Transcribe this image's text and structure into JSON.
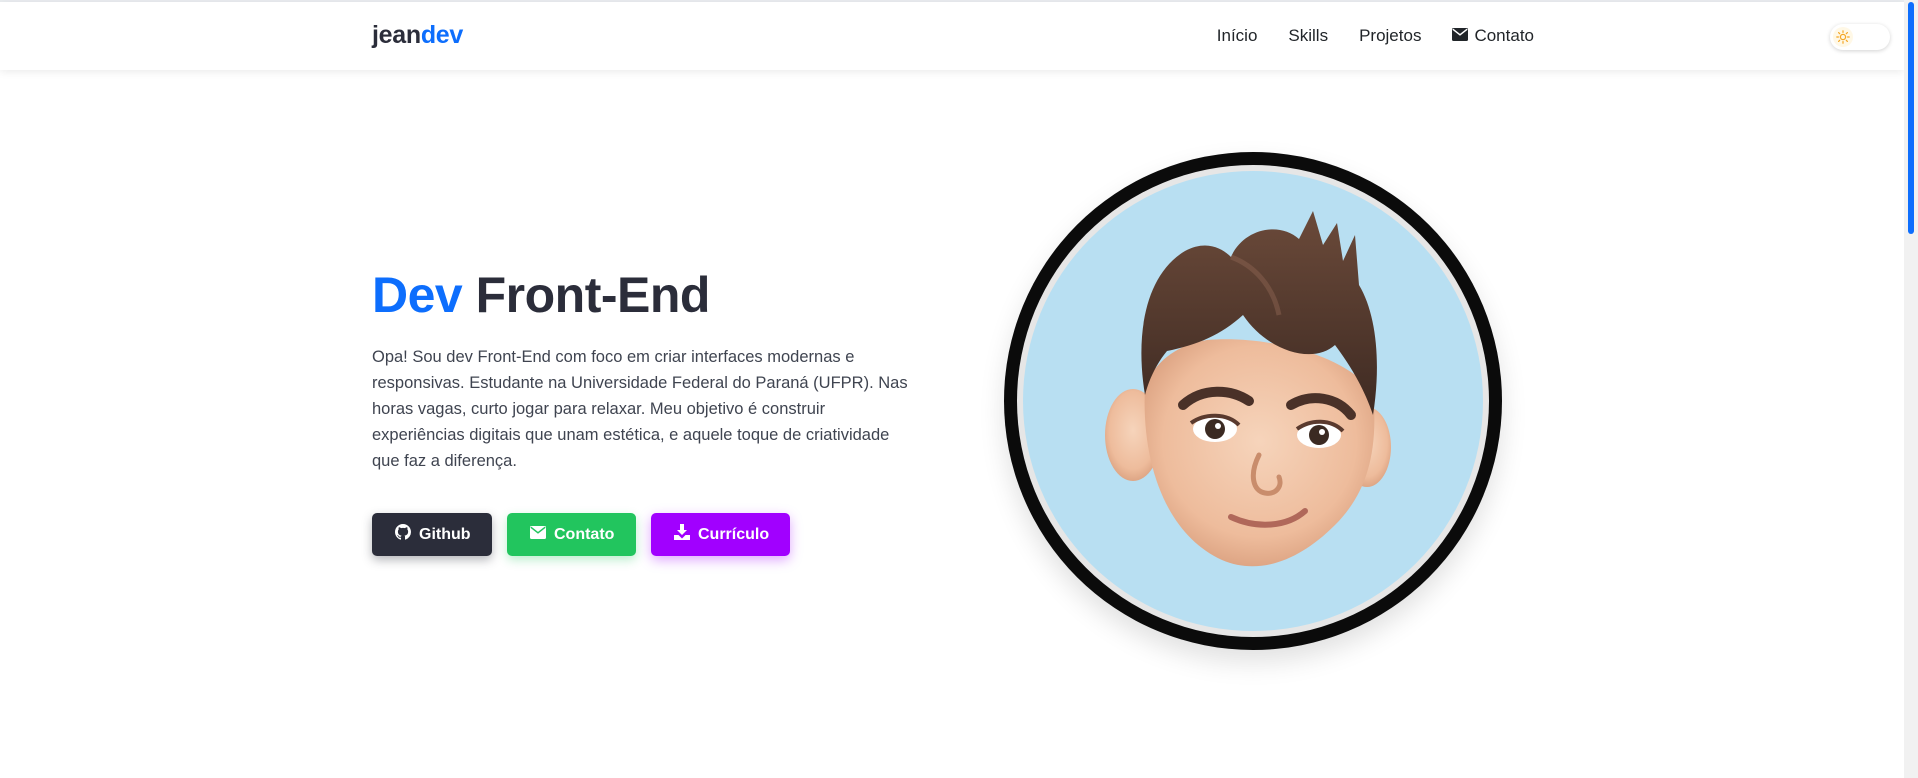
{
  "brand": {
    "part1": "jean",
    "part2": "dev"
  },
  "nav": {
    "items": [
      {
        "label": "Início",
        "icon": ""
      },
      {
        "label": "Skills",
        "icon": ""
      },
      {
        "label": "Projetos",
        "icon": ""
      },
      {
        "label": "Contato",
        "icon": "envelope-icon"
      }
    ]
  },
  "theme_toggle": {
    "mode": "light",
    "icon": "sun-icon"
  },
  "hero": {
    "title_accent": "Dev",
    "title_rest": "Front-End",
    "description": "Opa! Sou dev Front-End com foco em criar interfaces modernas e responsivas. Estudante na Universidade Federal do Paraná (UFPR). Nas horas vagas, curto jogar para relaxar. Meu objetivo é construir experiências digitais que unam estética, e aquele toque de criatividade que faz a diferença.",
    "buttons": [
      {
        "label": "Github",
        "icon": "github-icon",
        "color": "#2b2d3a"
      },
      {
        "label": "Contato",
        "icon": "envelope-icon",
        "color": "#22c55e"
      },
      {
        "label": "Currículo",
        "icon": "download-icon",
        "color": "#a100ff"
      }
    ]
  },
  "avatar": {
    "description": "memoji-avatar"
  },
  "colors": {
    "accent": "#0d6efd",
    "dark": "#2b2d3a",
    "green": "#22c55e",
    "purple": "#a100ff"
  }
}
